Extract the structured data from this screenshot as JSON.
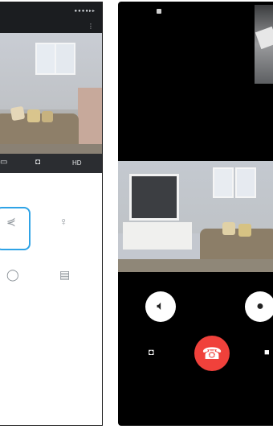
{
  "left_screen": {
    "status_bar": {
      "signal": "●●●●▸▸"
    },
    "app_bar": {
      "title": "",
      "menu_icon": "more-icon"
    },
    "video_controls": [
      {
        "icon": "screenshot-icon",
        "label": ""
      },
      {
        "icon": "camera-icon",
        "label": ""
      },
      {
        "icon": "hd-icon",
        "label": ""
      }
    ],
    "tabs": [
      {
        "label": ""
      },
      {
        "label": ""
      }
    ],
    "tiles": [
      {
        "icon": "share-icon",
        "label": ""
      },
      {
        "icon": "bulb-icon",
        "label": ""
      },
      {
        "icon": "rotate-icon",
        "label": ""
      },
      {
        "icon": "grid-icon",
        "label": ""
      }
    ],
    "accent_color": "#2fa3e6"
  },
  "right_screen": {
    "call_timer": "",
    "speaker_icon": "speaker-icon",
    "mic_icon": "mic-icon",
    "hangup_icon": "hangup-icon",
    "hangup_color": "#f0413b",
    "bottom_actions": [
      {
        "icon": "camera-icon",
        "label": ""
      },
      {
        "icon": "switch-icon",
        "label": ""
      }
    ]
  }
}
